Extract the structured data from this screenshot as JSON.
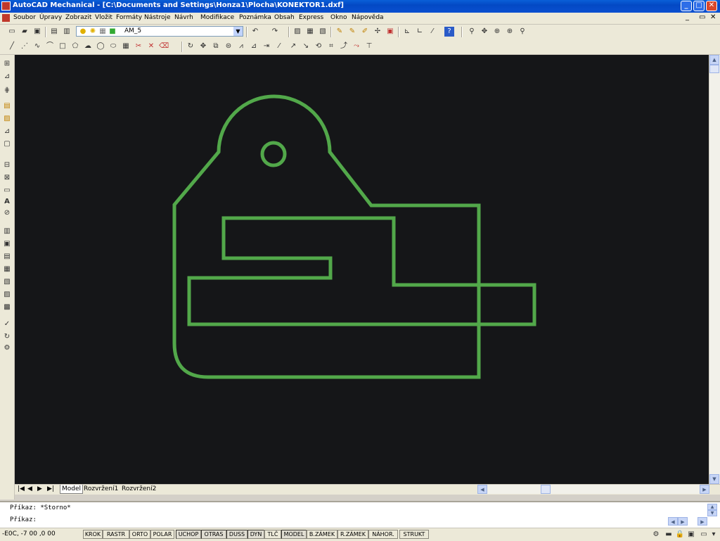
{
  "window": {
    "title": "AutoCAD Mechanical - [C:\\Documents and Settings\\Honza1\\Plocha\\KONEKTOR1.dxf]",
    "minimize": "_",
    "maximize": "□",
    "close": "✕"
  },
  "menu": {
    "items": [
      "Soubor",
      "Úpravy",
      "Zobrazit",
      "Vložit",
      "Formáty",
      "Nástroje",
      "Návrh",
      "Modifikace",
      "Poznámka",
      "Obsah",
      "Express",
      "Okno",
      "Nápověda"
    ],
    "mdi_minimize": "_",
    "mdi_restore": "▭",
    "mdi_close": "✕"
  },
  "toolbar": {
    "layer_name": "AM_5"
  },
  "tabs": {
    "items": [
      "Model",
      "Rozvržení1",
      "Rozvržení2"
    ],
    "active": "Model"
  },
  "command": {
    "line1": "Příkaz: *Storno*",
    "line2": "Příkaz:"
  },
  "status": {
    "coords": "-E0C, -7 00 ,0 00",
    "buttons": [
      "KROK",
      "RASTR",
      "ORTO",
      "POLAR",
      "UCHOP",
      "OTRAS",
      "DUSS",
      "DYN",
      "TLČ",
      "MODEL",
      "B.ZÁMEK",
      "R.ZÁMEK",
      "NÁHOR.",
      "STRUKT"
    ]
  },
  "colors": {
    "drawing_bg": "#151618",
    "geometry": "#52a84a"
  },
  "icons": {
    "left": [
      "line-icon",
      "polyline-icon",
      "construction-icon",
      "layer-icon",
      "hatch-icon",
      "dimension-icon",
      "block-icon",
      "insert-icon",
      "text-icon",
      "mtext-icon",
      "table-icon",
      "region-icon",
      "gradient-icon",
      "point-icon",
      "wipeout-icon",
      "revcloud-icon",
      "ellipse-icon",
      "check-icon",
      "rotate-icon",
      "gear-icon"
    ]
  }
}
